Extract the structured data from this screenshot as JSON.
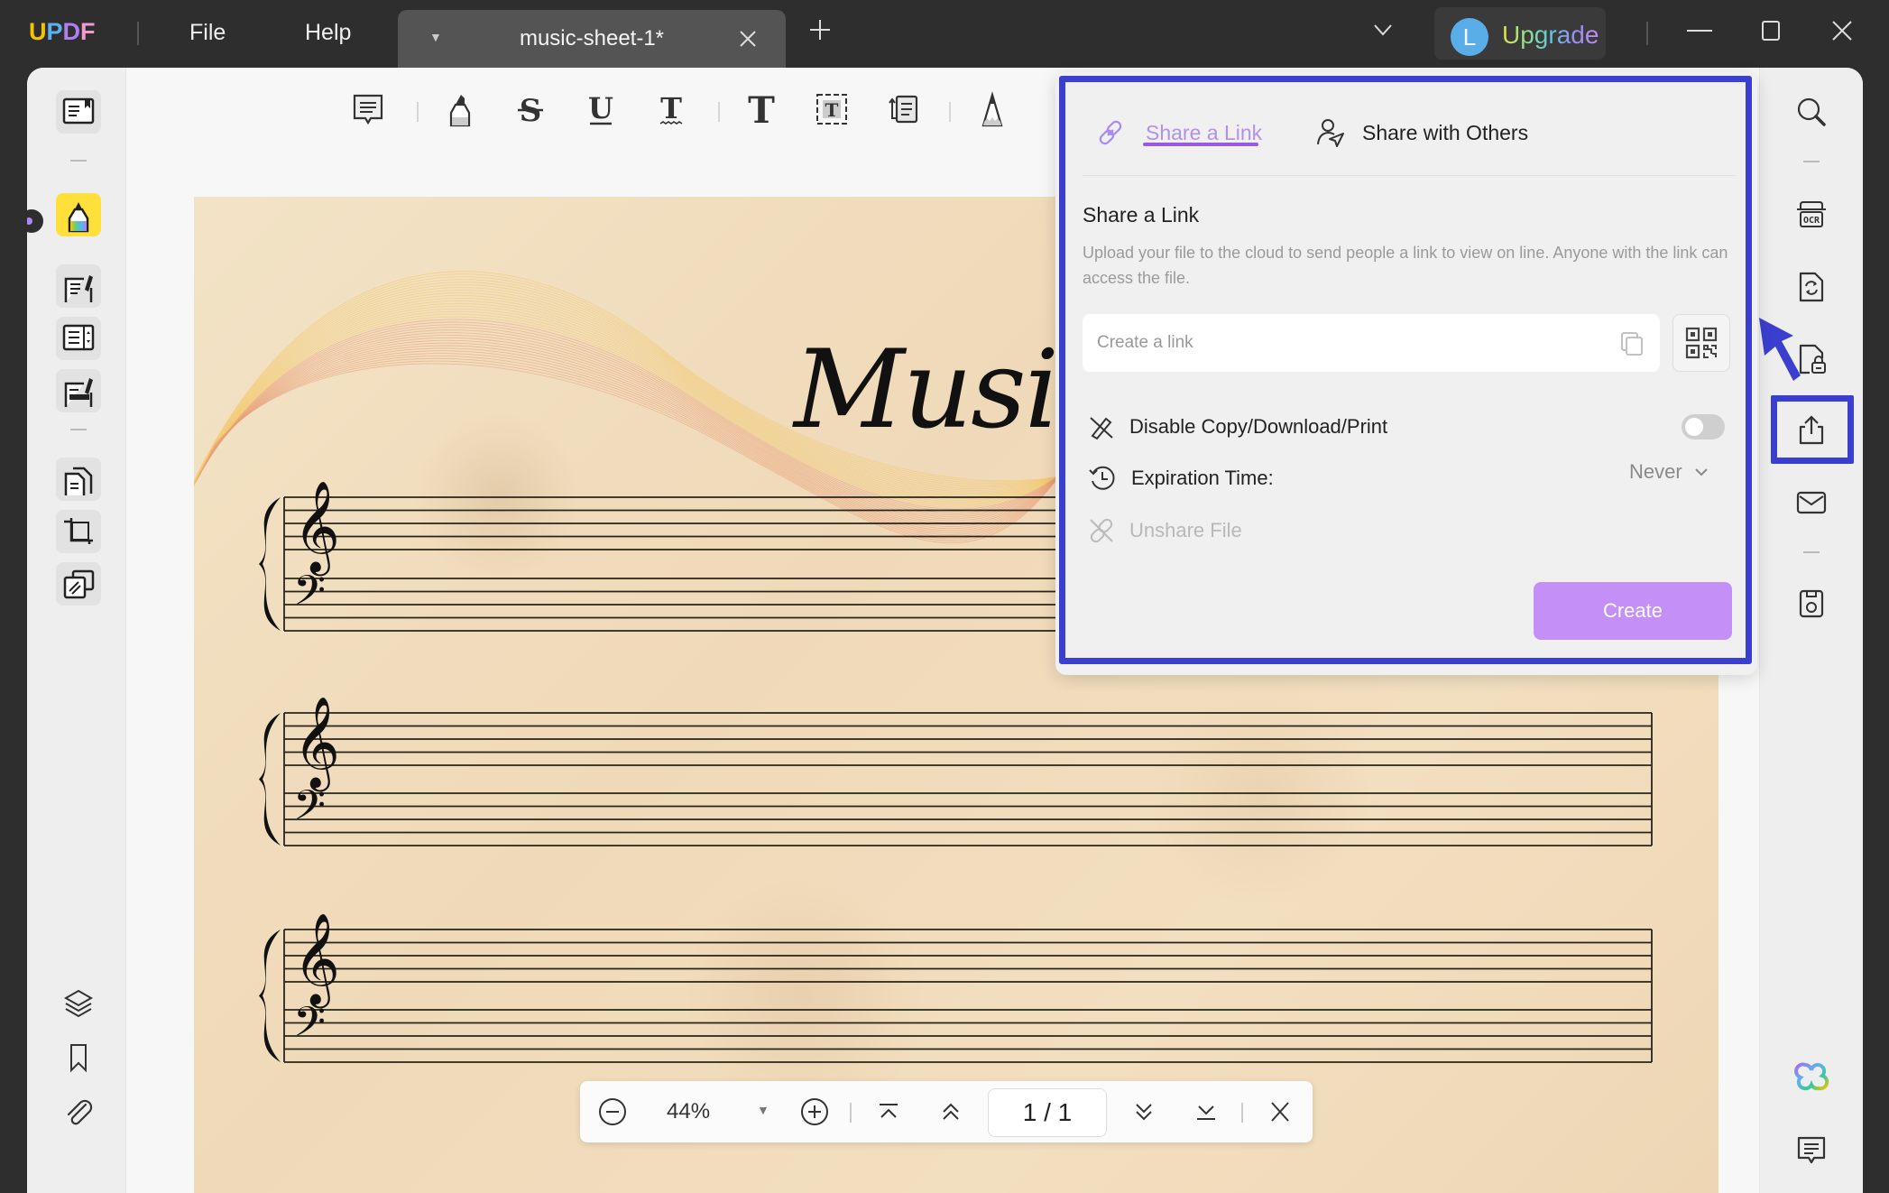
{
  "titlebar": {
    "logo": [
      "U",
      "P",
      "D",
      "F"
    ],
    "logo_colors": [
      "#f5c400",
      "#5ab3f0",
      "#b17ef0",
      "#f09ad0"
    ],
    "menu": {
      "file": "File",
      "help": "Help"
    },
    "tab": {
      "title": "music-sheet-1*",
      "close_label": "×"
    },
    "new_tab_label": "+",
    "upgrade": {
      "avatar_initial": "L",
      "label": "Upgrade"
    }
  },
  "left_sidebar": {
    "items": [
      {
        "name": "reader",
        "label": "Reader"
      },
      {
        "name": "comment",
        "label": "Comment",
        "active": true
      },
      {
        "name": "edit-pdf",
        "label": "Edit PDF"
      },
      {
        "name": "form",
        "label": "Form"
      },
      {
        "name": "fill-sign",
        "label": "Fill & Sign"
      },
      {
        "name": "organize-pages",
        "label": "Organize Pages"
      },
      {
        "name": "crop",
        "label": "Crop Pages"
      },
      {
        "name": "redact",
        "label": "Redact"
      },
      {
        "name": "layers",
        "label": "Layers"
      },
      {
        "name": "bookmarks",
        "label": "Bookmarks"
      },
      {
        "name": "attachments",
        "label": "Attachments"
      }
    ]
  },
  "toolbar": {
    "tools": [
      "sticky-note",
      "highlighter",
      "strikethrough",
      "underline",
      "squiggly",
      "text-comment",
      "text-box",
      "callout",
      "pencil"
    ]
  },
  "document": {
    "title_text": "Music"
  },
  "share_panel": {
    "tabs": [
      {
        "label": "Share a Link",
        "active": true
      },
      {
        "label": "Share with Others",
        "active": false
      }
    ],
    "heading": "Share a Link",
    "description": "Upload your file to the cloud to send people a link to view on line. Anyone with the link can access the file.",
    "link_input": {
      "placeholder": "Create a link",
      "value": ""
    },
    "disable_copy": {
      "label": "Disable Copy/Download/Print",
      "enabled": false
    },
    "expiration": {
      "label": "Expiration Time:",
      "value": "Never"
    },
    "unshare": {
      "label": "Unshare File",
      "disabled": true
    },
    "create_button": "Create",
    "accent_color": "#b391e8",
    "button_color": "#c490f8"
  },
  "right_sidebar": {
    "items": [
      "search",
      "ocr",
      "convert",
      "protect",
      "share",
      "email",
      "save",
      "ai-assistant",
      "comments"
    ],
    "highlighted": "share"
  },
  "bottom_nav": {
    "zoom": "44%",
    "page_display": "1 / 1",
    "current_page": 1,
    "total_pages": 1
  },
  "annotation": {
    "color": "#3a3fcf"
  }
}
